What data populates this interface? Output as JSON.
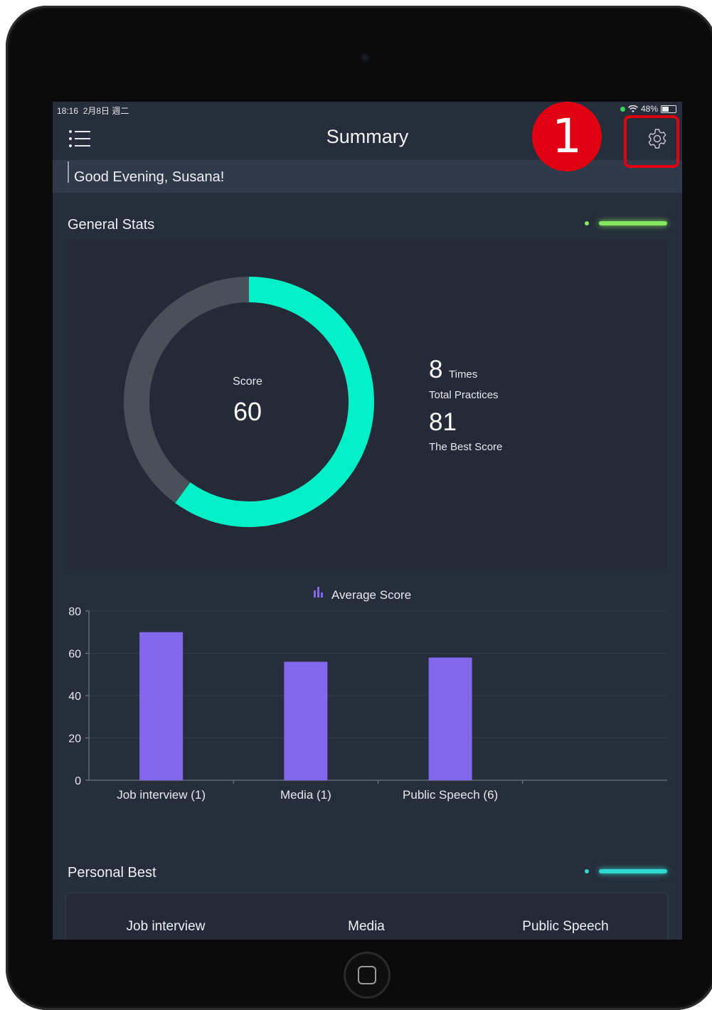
{
  "status_bar": {
    "time": "18:16",
    "date": "2月8日 週二",
    "battery": "48%"
  },
  "nav": {
    "title": "Summary",
    "menu_icon": "list-menu-icon",
    "settings_icon": "gear-icon"
  },
  "annotation": {
    "step": "1",
    "color": "#e00010"
  },
  "greeting": "Good Evening, Susana!",
  "general_stats": {
    "title": "General Stats",
    "accent_color": "#86e85f",
    "score_label": "Score",
    "score_value": "60",
    "total_practices_value": "8",
    "total_practices_unit": "Times",
    "total_practices_label": "Total Practices",
    "best_score_value": "81",
    "best_score_label": "The Best Score",
    "score_fraction": 0.6,
    "colors": {
      "filled": "#00f0c8",
      "track": "#4a505a"
    }
  },
  "chart_data": {
    "type": "bar",
    "title": "Average Score",
    "categories": [
      "Job interview (1)",
      "Media (1)",
      "Public Speech (6)"
    ],
    "values": [
      70,
      56,
      58
    ],
    "ylim": [
      0,
      80
    ],
    "yticks": [
      0,
      20,
      40,
      60,
      80
    ],
    "grid": true,
    "bar_color": "#8468ec"
  },
  "personal_best": {
    "title": "Personal Best",
    "accent_color": "#2fd8d0",
    "tabs": [
      "Job interview",
      "Media",
      "Public Speech"
    ]
  }
}
